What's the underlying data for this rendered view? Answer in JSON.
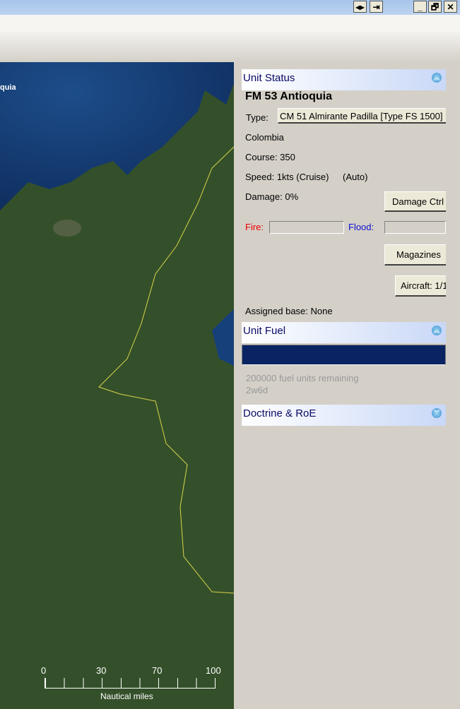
{
  "window": {
    "buttons": [
      "◂▸",
      "⇥",
      "_",
      "🗗",
      "✕"
    ]
  },
  "map": {
    "label": "quia",
    "scale": {
      "ticks": [
        "0",
        "30",
        "70",
        "100"
      ],
      "unit": "Nautical miles"
    }
  },
  "unit_status": {
    "header": "Unit Status",
    "name": "FM 53 Antioquia",
    "type_label": "Type:",
    "type_value": "CM 51 Almirante Padilla [Type FS 1500]",
    "country": "Colombia",
    "course": "Course: 350",
    "speed": "Speed: 1kts (Cruise)",
    "speed_mode": "(Auto)",
    "damage": "Damage: 0%",
    "damage_ctrl": "Damage Ctrl",
    "fire_label": "Fire:",
    "flood_label": "Flood:",
    "magazines": "Magazines",
    "aircraft": "Aircraft: 1/1",
    "assigned_base": "Assigned base: None"
  },
  "unit_fuel": {
    "header": "Unit Fuel",
    "fuel_fraction": 1.0,
    "fuel_color": "#0a2463",
    "remaining": "200000 fuel units remaining",
    "duration": "2w6d"
  },
  "doctrine": {
    "header": "Doctrine & RoE"
  }
}
